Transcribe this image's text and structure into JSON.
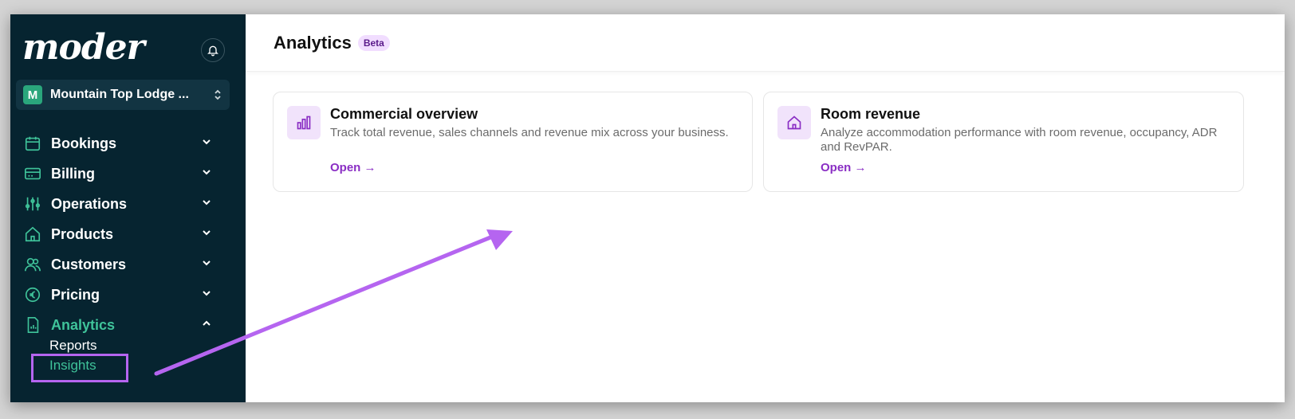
{
  "sidebar": {
    "logo": "moder",
    "property": {
      "badge": "M",
      "name": "Mountain Top Lodge ..."
    },
    "items": [
      {
        "label": "Bookings",
        "icon": "calendar-icon"
      },
      {
        "label": "Billing",
        "icon": "credit-card-icon"
      },
      {
        "label": "Operations",
        "icon": "sliders-icon"
      },
      {
        "label": "Products",
        "icon": "home-icon"
      },
      {
        "label": "Customers",
        "icon": "users-icon"
      },
      {
        "label": "Pricing",
        "icon": "euro-icon"
      },
      {
        "label": "Analytics",
        "icon": "report-icon"
      }
    ],
    "subitems": {
      "reports": "Reports",
      "insights": "Insights"
    }
  },
  "header": {
    "title": "Analytics",
    "badge": "Beta"
  },
  "cards": [
    {
      "title": "Commercial overview",
      "description": "Track total revenue, sales channels and revenue mix across your business.",
      "link": "Open →",
      "icon": "bar-chart-icon"
    },
    {
      "title": "Room revenue",
      "description": "Analyze accommodation performance with room revenue, occupancy, ADR and RevPAR.",
      "link": "Open →",
      "icon": "home-icon"
    }
  ],
  "colors": {
    "sidebar_bg": "#062430",
    "accent_green": "#3fc39a",
    "accent_purple": "#8a2ec4",
    "annotation": "#b565f0"
  }
}
